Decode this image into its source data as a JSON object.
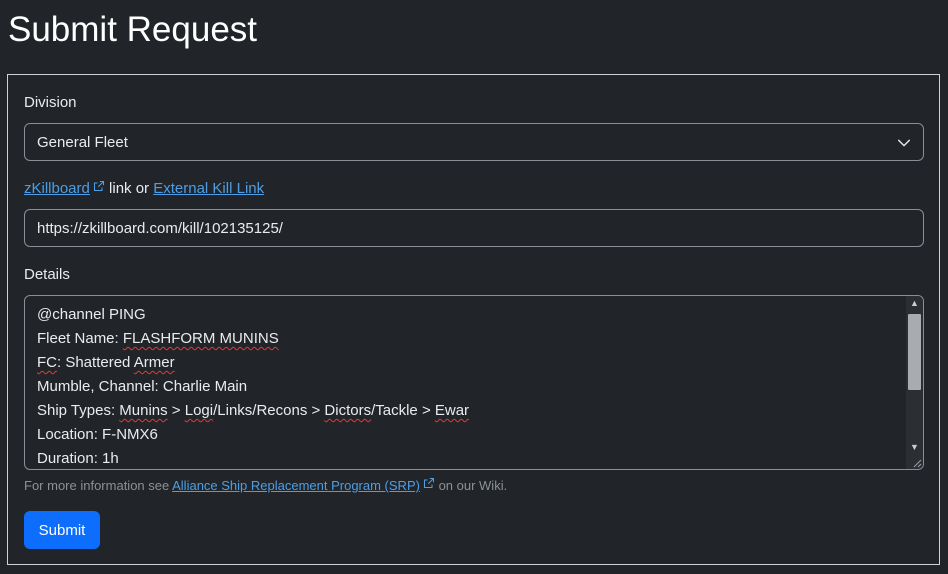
{
  "page": {
    "title": "Submit Request"
  },
  "form": {
    "division": {
      "label": "Division",
      "selected": "General Fleet"
    },
    "link": {
      "zkill_text": "zKillboard",
      "middle_text": " link or ",
      "external_text": "External Kill Link",
      "value": "https://zkillboard.com/kill/102135125/"
    },
    "details": {
      "label": "Details",
      "lines": [
        [
          "@channel PING"
        ],
        [
          "Fleet Name: ",
          {
            "t": "FLASHFORM MUNINS",
            "sp": true
          }
        ],
        [
          {
            "t": "FC",
            "sp": true
          },
          ": Shattered ",
          {
            "t": "Armer",
            "sp": true
          }
        ],
        [
          "Mumble, Channel: Charlie Main"
        ],
        [
          "Ship Types: ",
          {
            "t": "Munins",
            "sp": true
          },
          " > ",
          {
            "t": "Logi",
            "sp": true
          },
          "/Links/Recons > ",
          {
            "t": "Dictors",
            "sp": true
          },
          "/Tackle > ",
          {
            "t": "Ewar",
            "sp": true
          }
        ],
        [
          "Location: F-NMX6"
        ],
        [
          "Duration: 1h"
        ]
      ]
    },
    "help": {
      "prefix": "For more information see ",
      "link_text": "Alliance Ship Replacement Program (SRP)",
      "suffix": " on our Wiki."
    },
    "submit_label": "Submit"
  },
  "colors": {
    "accent": "#0d6efd",
    "link": "#4d9ee6",
    "background": "#212529"
  },
  "icons": {
    "external_link": "external-link-icon",
    "select_chevron": "chevron-down-icon"
  }
}
